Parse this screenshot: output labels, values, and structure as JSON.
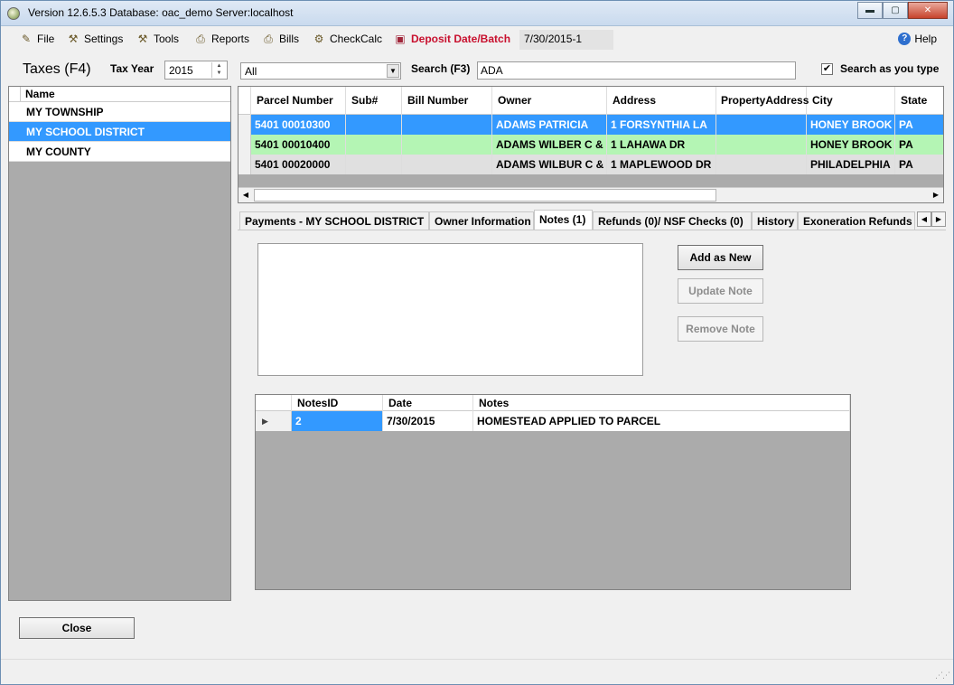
{
  "window": {
    "title": "Version 12.6.5.3 Database: oac_demo Server:localhost",
    "controls": {
      "minimize": "▬",
      "maximize": "▢",
      "close": "✕"
    }
  },
  "menu": {
    "items": [
      {
        "label": "File",
        "icon": "file-icon",
        "glyph": "✎"
      },
      {
        "label": "Settings",
        "icon": "settings-wand-icon",
        "glyph": "⚒"
      },
      {
        "label": "Tools",
        "icon": "tools-icon",
        "glyph": "⚒"
      },
      {
        "label": "Reports",
        "icon": "reports-icon",
        "glyph": "⎙"
      },
      {
        "label": "Bills",
        "icon": "bills-icon",
        "glyph": "⎙"
      },
      {
        "label": "CheckCalc",
        "icon": "checkcalc-icon",
        "glyph": "⚙"
      },
      {
        "label": "Deposit Date/Batch",
        "icon": "deposit-box-icon",
        "glyph": "▣"
      }
    ],
    "batch_value": "7/30/2015-1",
    "help_label": "Help",
    "help_glyph": "?",
    "accent_color": "#c8102e"
  },
  "toolbar": {
    "title": "Taxes (F4)",
    "tax_year_label": "Tax Year",
    "tax_year_value": "2015",
    "filter_value": "All",
    "search_label": "Search (F3)",
    "search_value": "ADA",
    "search_as_you_type_label": "Search as you type",
    "search_as_you_type_checked": "✔"
  },
  "districts": {
    "header": "Name",
    "rows": [
      "MY TOWNSHIP",
      "MY SCHOOL DISTRICT",
      "MY COUNTY"
    ],
    "selected_index": 1
  },
  "close_label": "Close",
  "parcels": {
    "columns": [
      "Parcel Number",
      "Sub#",
      "Bill Number",
      "Owner",
      "Address",
      "PropertyAddress",
      "City",
      "State"
    ],
    "rows": [
      [
        "5401 00010300",
        "",
        "",
        "ADAMS PATRICIA",
        "1 FORSYNTHIA LA",
        "",
        "HONEY BROOK",
        "PA"
      ],
      [
        "5401 00010400",
        "",
        "",
        "ADAMS WILBER C &",
        "1 LAHAWA DR",
        "",
        "HONEY BROOK",
        "PA"
      ],
      [
        "5401 00020000",
        "",
        "",
        "ADAMS WILBUR C &",
        "1 MAPLEWOOD DR",
        "",
        "PHILADELPHIA",
        "PA"
      ]
    ],
    "row_colors": [
      "#3399ff",
      "#b4f5b4",
      "#e0e0e0"
    ]
  },
  "tabs": {
    "items": [
      "Payments - MY SCHOOL DISTRICT",
      "Owner Information",
      "Notes (1)",
      "Refunds (0)/ NSF Checks (0)",
      "History",
      "Exoneration Refunds ("
    ],
    "active_index": 2
  },
  "notes_panel": {
    "add_label": "Add as New",
    "update_label": "Update Note",
    "remove_label": "Remove Note",
    "grid": {
      "columns": [
        "NotesID",
        "Date",
        "Notes"
      ],
      "rows": [
        [
          "2",
          "7/30/2015",
          "HOMESTEAD APPLIED TO PARCEL"
        ]
      ]
    }
  }
}
